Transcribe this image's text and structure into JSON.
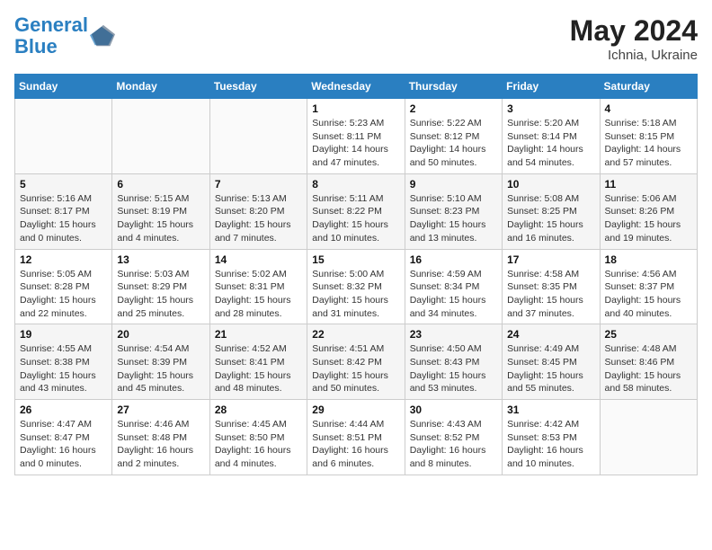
{
  "header": {
    "logo_line1": "General",
    "logo_line2": "Blue",
    "month_year": "May 2024",
    "location": "Ichnia, Ukraine"
  },
  "weekdays": [
    "Sunday",
    "Monday",
    "Tuesday",
    "Wednesday",
    "Thursday",
    "Friday",
    "Saturday"
  ],
  "weeks": [
    [
      {
        "day": "",
        "info": ""
      },
      {
        "day": "",
        "info": ""
      },
      {
        "day": "",
        "info": ""
      },
      {
        "day": "1",
        "info": "Sunrise: 5:23 AM\nSunset: 8:11 PM\nDaylight: 14 hours and 47 minutes."
      },
      {
        "day": "2",
        "info": "Sunrise: 5:22 AM\nSunset: 8:12 PM\nDaylight: 14 hours and 50 minutes."
      },
      {
        "day": "3",
        "info": "Sunrise: 5:20 AM\nSunset: 8:14 PM\nDaylight: 14 hours and 54 minutes."
      },
      {
        "day": "4",
        "info": "Sunrise: 5:18 AM\nSunset: 8:15 PM\nDaylight: 14 hours and 57 minutes."
      }
    ],
    [
      {
        "day": "5",
        "info": "Sunrise: 5:16 AM\nSunset: 8:17 PM\nDaylight: 15 hours and 0 minutes."
      },
      {
        "day": "6",
        "info": "Sunrise: 5:15 AM\nSunset: 8:19 PM\nDaylight: 15 hours and 4 minutes."
      },
      {
        "day": "7",
        "info": "Sunrise: 5:13 AM\nSunset: 8:20 PM\nDaylight: 15 hours and 7 minutes."
      },
      {
        "day": "8",
        "info": "Sunrise: 5:11 AM\nSunset: 8:22 PM\nDaylight: 15 hours and 10 minutes."
      },
      {
        "day": "9",
        "info": "Sunrise: 5:10 AM\nSunset: 8:23 PM\nDaylight: 15 hours and 13 minutes."
      },
      {
        "day": "10",
        "info": "Sunrise: 5:08 AM\nSunset: 8:25 PM\nDaylight: 15 hours and 16 minutes."
      },
      {
        "day": "11",
        "info": "Sunrise: 5:06 AM\nSunset: 8:26 PM\nDaylight: 15 hours and 19 minutes."
      }
    ],
    [
      {
        "day": "12",
        "info": "Sunrise: 5:05 AM\nSunset: 8:28 PM\nDaylight: 15 hours and 22 minutes."
      },
      {
        "day": "13",
        "info": "Sunrise: 5:03 AM\nSunset: 8:29 PM\nDaylight: 15 hours and 25 minutes."
      },
      {
        "day": "14",
        "info": "Sunrise: 5:02 AM\nSunset: 8:31 PM\nDaylight: 15 hours and 28 minutes."
      },
      {
        "day": "15",
        "info": "Sunrise: 5:00 AM\nSunset: 8:32 PM\nDaylight: 15 hours and 31 minutes."
      },
      {
        "day": "16",
        "info": "Sunrise: 4:59 AM\nSunset: 8:34 PM\nDaylight: 15 hours and 34 minutes."
      },
      {
        "day": "17",
        "info": "Sunrise: 4:58 AM\nSunset: 8:35 PM\nDaylight: 15 hours and 37 minutes."
      },
      {
        "day": "18",
        "info": "Sunrise: 4:56 AM\nSunset: 8:37 PM\nDaylight: 15 hours and 40 minutes."
      }
    ],
    [
      {
        "day": "19",
        "info": "Sunrise: 4:55 AM\nSunset: 8:38 PM\nDaylight: 15 hours and 43 minutes."
      },
      {
        "day": "20",
        "info": "Sunrise: 4:54 AM\nSunset: 8:39 PM\nDaylight: 15 hours and 45 minutes."
      },
      {
        "day": "21",
        "info": "Sunrise: 4:52 AM\nSunset: 8:41 PM\nDaylight: 15 hours and 48 minutes."
      },
      {
        "day": "22",
        "info": "Sunrise: 4:51 AM\nSunset: 8:42 PM\nDaylight: 15 hours and 50 minutes."
      },
      {
        "day": "23",
        "info": "Sunrise: 4:50 AM\nSunset: 8:43 PM\nDaylight: 15 hours and 53 minutes."
      },
      {
        "day": "24",
        "info": "Sunrise: 4:49 AM\nSunset: 8:45 PM\nDaylight: 15 hours and 55 minutes."
      },
      {
        "day": "25",
        "info": "Sunrise: 4:48 AM\nSunset: 8:46 PM\nDaylight: 15 hours and 58 minutes."
      }
    ],
    [
      {
        "day": "26",
        "info": "Sunrise: 4:47 AM\nSunset: 8:47 PM\nDaylight: 16 hours and 0 minutes."
      },
      {
        "day": "27",
        "info": "Sunrise: 4:46 AM\nSunset: 8:48 PM\nDaylight: 16 hours and 2 minutes."
      },
      {
        "day": "28",
        "info": "Sunrise: 4:45 AM\nSunset: 8:50 PM\nDaylight: 16 hours and 4 minutes."
      },
      {
        "day": "29",
        "info": "Sunrise: 4:44 AM\nSunset: 8:51 PM\nDaylight: 16 hours and 6 minutes."
      },
      {
        "day": "30",
        "info": "Sunrise: 4:43 AM\nSunset: 8:52 PM\nDaylight: 16 hours and 8 minutes."
      },
      {
        "day": "31",
        "info": "Sunrise: 4:42 AM\nSunset: 8:53 PM\nDaylight: 16 hours and 10 minutes."
      },
      {
        "day": "",
        "info": ""
      }
    ]
  ]
}
